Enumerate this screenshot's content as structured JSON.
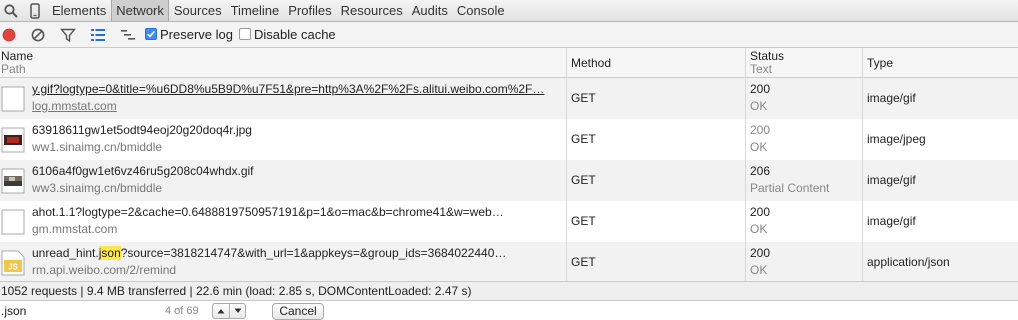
{
  "tabs": [
    "Elements",
    "Network",
    "Sources",
    "Timeline",
    "Profiles",
    "Resources",
    "Audits",
    "Console"
  ],
  "active_tab": "Network",
  "toolbar": {
    "icons": [
      "record-icon",
      "clear-icon",
      "filter-icon",
      "large-rows-icon",
      "overview-icon"
    ],
    "preserve_log_label": "Preserve log",
    "preserve_log_checked": true,
    "disable_cache_label": "Disable cache",
    "disable_cache_checked": false
  },
  "columns": {
    "name": "Name",
    "path": "Path",
    "method": "Method",
    "status": "Status",
    "text": "Text",
    "type": "Type"
  },
  "rows": [
    {
      "name": "y.gif?logtype=0&title=%u6DD8%u5B9D%u7F51&pre=http%3A%2F%2Fs.alitui.weibo.com%2F…",
      "domain": "log.mmstat.com",
      "method": "GET",
      "status": "200",
      "status_text": "OK",
      "type": "image/gif",
      "icon": "blank-file-icon"
    },
    {
      "name": "63918611gw1et5odt94eoj20g20doq4r.jpg",
      "domain": "ww1.sinaimg.cn/bmiddle",
      "method": "GET",
      "status": "200",
      "status_text": "OK",
      "type": "image/jpeg",
      "icon": "image-thumbnail-icon"
    },
    {
      "name": "6106a4f0gw1et6vz46ru5g208c04whdx.gif",
      "domain": "ww3.sinaimg.cn/bmiddle",
      "method": "GET",
      "status": "206",
      "status_text": "Partial Content",
      "type": "image/gif",
      "icon": "image-thumbnail-icon"
    },
    {
      "name": "ahot.1.1?logtype=2&cache=0.6488819750957191&p=1&o=mac&b=chrome41&w=web…",
      "domain": "gm.mmstat.com",
      "method": "GET",
      "status": "200",
      "status_text": "OK",
      "type": "image/gif",
      "icon": "blank-file-icon"
    },
    {
      "name_pre": "unread_hint.",
      "name_match": "json",
      "name_post": "?source=3818214747&with_url=1&appkeys=&group_ids=3684022440…",
      "domain": "rm.api.weibo.com/2/remind",
      "method": "GET",
      "status": "200",
      "status_text": "OK",
      "type": "application/json",
      "icon": "js-file-icon"
    }
  ],
  "summary": "1052 requests | 9.4 MB transferred | 22.6 min (load: 2.85 s, DOMContentLoaded: 2.47 s)",
  "search": {
    "value": ".json",
    "match_count": "4 of 69",
    "cancel_label": "Cancel"
  },
  "colors": {
    "record": "#e0443e",
    "checkbox_on": "#3b8df5",
    "highlight": "#fde54e"
  }
}
